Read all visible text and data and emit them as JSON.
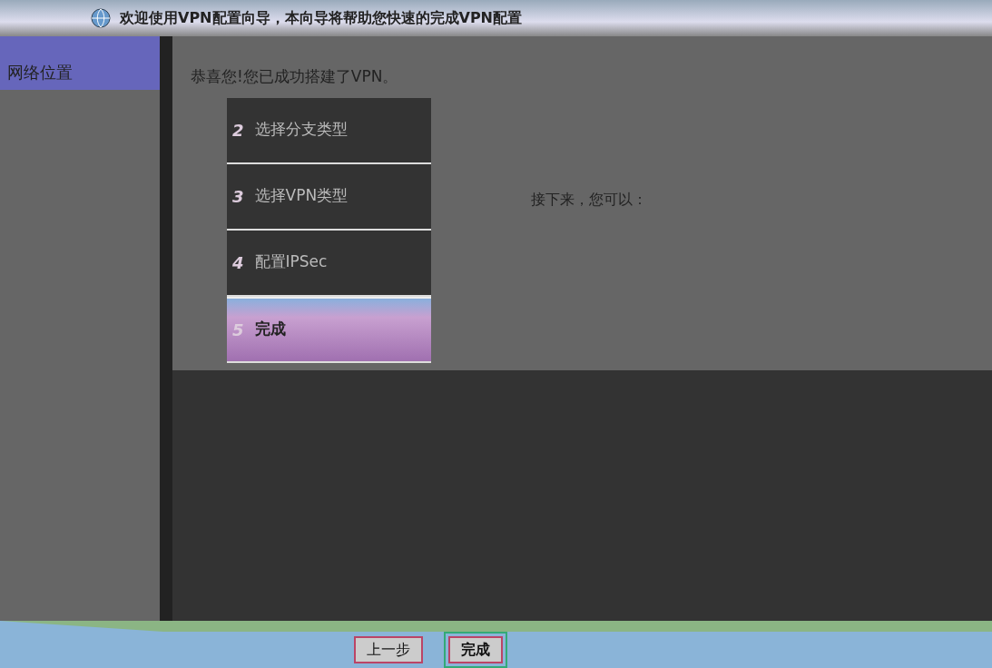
{
  "window": {
    "title": "欢迎使用VPN配置向导，本向导将帮助您快速的完成VPN配置"
  },
  "sidebar": {
    "header": "网络位置"
  },
  "content": {
    "message": "恭喜您!您已成功搭建了VPN。",
    "next_heading": "接下来，您可以："
  },
  "steps": [
    {
      "number": "2",
      "label": "选择分支类型",
      "selected": false
    },
    {
      "number": "3",
      "label": "选择VPN类型",
      "selected": false
    },
    {
      "number": "4",
      "label": "配置IPSec",
      "selected": false
    },
    {
      "number": "5",
      "label": "完成",
      "selected": true
    }
  ],
  "buttons": [
    {
      "label": "上一步",
      "kind": "secondary"
    },
    {
      "label": "完成",
      "kind": "primary"
    }
  ]
}
